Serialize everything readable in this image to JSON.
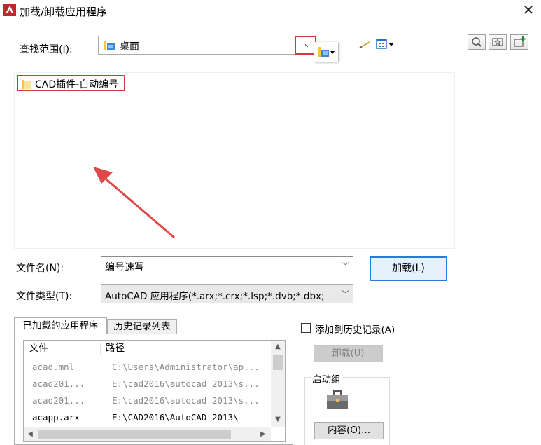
{
  "window": {
    "title": "加载/卸载应用程序",
    "close_glyph": "✕"
  },
  "lookin": {
    "label": "查找范围(I):",
    "value": "桌面"
  },
  "file_list": {
    "items": [
      {
        "label": "CAD插件-自动编号"
      }
    ]
  },
  "filename": {
    "label": "文件名(N):",
    "value": "编号速写"
  },
  "filetype": {
    "label": "文件类型(T):",
    "value": "AutoCAD 应用程序(*.arx;*.crx;*.lsp;*.dvb;*.dbx;"
  },
  "load_button": {
    "label": "加载(L)"
  },
  "tabs": {
    "loaded": "已加载的应用程序",
    "history": "历史记录列表"
  },
  "loaded_table": {
    "headers": {
      "file": "文件",
      "path": "路径"
    },
    "rows": [
      {
        "file": "acad.mnl",
        "path": "C:\\Users\\Administrator\\ap...",
        "dim": true
      },
      {
        "file": "acad201...",
        "path": "E:\\cad2016\\autocad 2013\\s...",
        "dim": true
      },
      {
        "file": "acad201...",
        "path": "E:\\cad2016\\autocad 2013\\s...",
        "dim": true
      },
      {
        "file": "acapp.arx",
        "path": "E:\\CAD2016\\AutoCAD 2013\\",
        "dim": false
      }
    ]
  },
  "history_checkbox": {
    "label": "添加到历史记录(A)",
    "checked": false
  },
  "unload_button": {
    "label": "卸载(U)"
  },
  "startup": {
    "label": "启动组",
    "contents_button": "内容(O)..."
  },
  "colors": {
    "highlight_red": "#d33a3a",
    "default_button_border": "#2a7bd4",
    "folder_yellow": "#f4c542"
  }
}
